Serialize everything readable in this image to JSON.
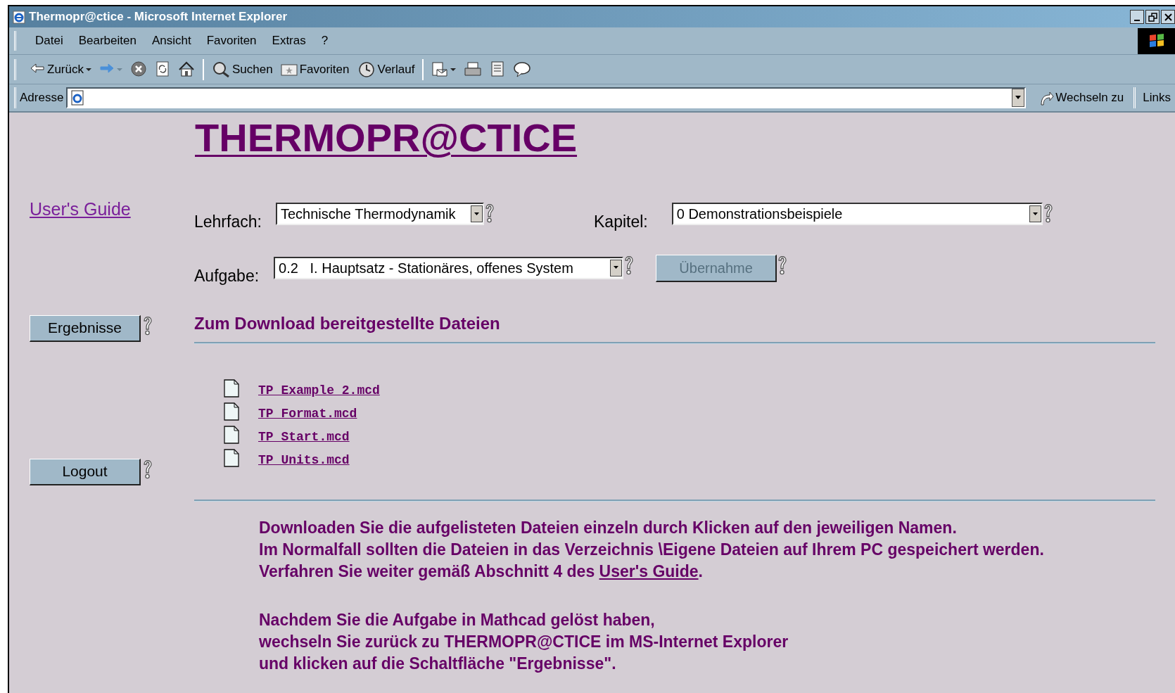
{
  "window": {
    "title": "Thermopr@ctice - Microsoft Internet Explorer"
  },
  "menu": [
    "Datei",
    "Bearbeiten",
    "Ansicht",
    "Favoriten",
    "Extras",
    "?"
  ],
  "toolbar": [
    {
      "kind": "back",
      "label": "Zurück"
    },
    {
      "kind": "forward"
    },
    {
      "kind": "stop"
    },
    {
      "kind": "refresh"
    },
    {
      "kind": "home"
    },
    {
      "kind": "separator"
    },
    {
      "kind": "search",
      "label": "Suchen"
    },
    {
      "kind": "favorites",
      "label": "Favoriten"
    },
    {
      "kind": "history",
      "label": "Verlauf"
    },
    {
      "kind": "separator"
    },
    {
      "kind": "mail"
    },
    {
      "kind": "print"
    },
    {
      "kind": "edit"
    },
    {
      "kind": "discuss"
    }
  ],
  "address_bar": {
    "label": "Adresse",
    "go_button": "Wechseln zu",
    "links": "Links"
  },
  "page": {
    "title": "THERMOPR@CTICE",
    "users_guide_link": "User's Guide",
    "subject": {
      "label": "Lehrfach:",
      "value": "Technische Thermodynamik"
    },
    "chapter": {
      "label": "Kapitel:",
      "value": "0 Demonstrationsbeispiele"
    },
    "task": {
      "label": "Aufgabe:",
      "value": "0.2   I. Hauptsatz - Stationäres, offenes System"
    },
    "take_button": {
      "label": "Übernahme",
      "disabled": true
    },
    "side_buttons": [
      "Ergebnisse",
      "Logout"
    ],
    "downloads_heading": "Zum Download bereitgestellte Dateien",
    "files": [
      "TP_Example_2.mcd",
      "TP_Format.mcd",
      "TP_Start.mcd",
      "TP_Units.mcd"
    ],
    "instructions": [
      [
        {
          "text": "Downloaden Sie die aufgelisteten Dateien einzeln durch Klicken auf den jeweiligen Namen."
        },
        {
          "text": "Im Normalfall sollten die Dateien in das Verzeichnis \\Eigene Dateien auf Ihrem PC gespeichert werden."
        },
        {
          "text": "Verfahren Sie weiter gemäß Abschnitt 4 des ",
          "link": "User's Guide",
          "after": "."
        }
      ],
      [
        {
          "text": "Nachdem Sie die Aufgabe in Mathcad gelöst haben,"
        },
        {
          "text": "wechseln Sie zurück zu THERMOPR@CTICE im MS-Internet Explorer"
        },
        {
          "text": "und klicken auf die Schaltfläche \"Ergebnisse\"."
        }
      ]
    ]
  }
}
